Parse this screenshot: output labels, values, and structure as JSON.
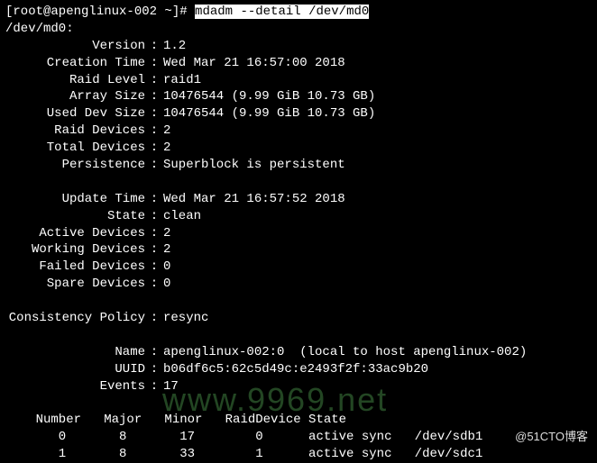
{
  "prompt": {
    "user_host": "[root@apenglinux-002 ~]# ",
    "command": "mdadm --detail /dev/md0"
  },
  "device_path": "/dev/md0:",
  "fields": {
    "version_label": "Version",
    "version_value": "1.2",
    "creation_time_label": "Creation Time",
    "creation_time_value": "Wed Mar 21 16:57:00 2018",
    "raid_level_label": "Raid Level",
    "raid_level_value": "raid1",
    "array_size_label": "Array Size",
    "array_size_value": "10476544 (9.99 GiB 10.73 GB)",
    "used_dev_size_label": "Used Dev Size",
    "used_dev_size_value": "10476544 (9.99 GiB 10.73 GB)",
    "raid_devices_label": "Raid Devices",
    "raid_devices_value": "2",
    "total_devices_label": "Total Devices",
    "total_devices_value": "2",
    "persistence_label": "Persistence",
    "persistence_value": "Superblock is persistent",
    "update_time_label": "Update Time",
    "update_time_value": "Wed Mar 21 16:57:52 2018",
    "state_label": "State",
    "state_value": "clean",
    "active_devices_label": "Active Devices",
    "active_devices_value": "2",
    "working_devices_label": "Working Devices",
    "working_devices_value": "2",
    "failed_devices_label": "Failed Devices",
    "failed_devices_value": "0",
    "spare_devices_label": "Spare Devices",
    "spare_devices_value": "0",
    "consistency_policy_label": "Consistency Policy",
    "consistency_policy_value": "resync",
    "name_label": "Name",
    "name_value": "apenglinux-002:0  (local to host apenglinux-002)",
    "uuid_label": "UUID",
    "uuid_value": "b06df6c5:62c5d49c:e2493f2f:33ac9b20",
    "events_label": "Events",
    "events_value": "17"
  },
  "table": {
    "header": "    Number   Major   Minor   RaidDevice State",
    "rows": [
      "       0       8       17        0      active sync   /dev/sdb1",
      "       1       8       33        1      active sync   /dev/sdc1"
    ]
  },
  "watermark": "www.9969.net",
  "attribution": "@51CTO博客"
}
